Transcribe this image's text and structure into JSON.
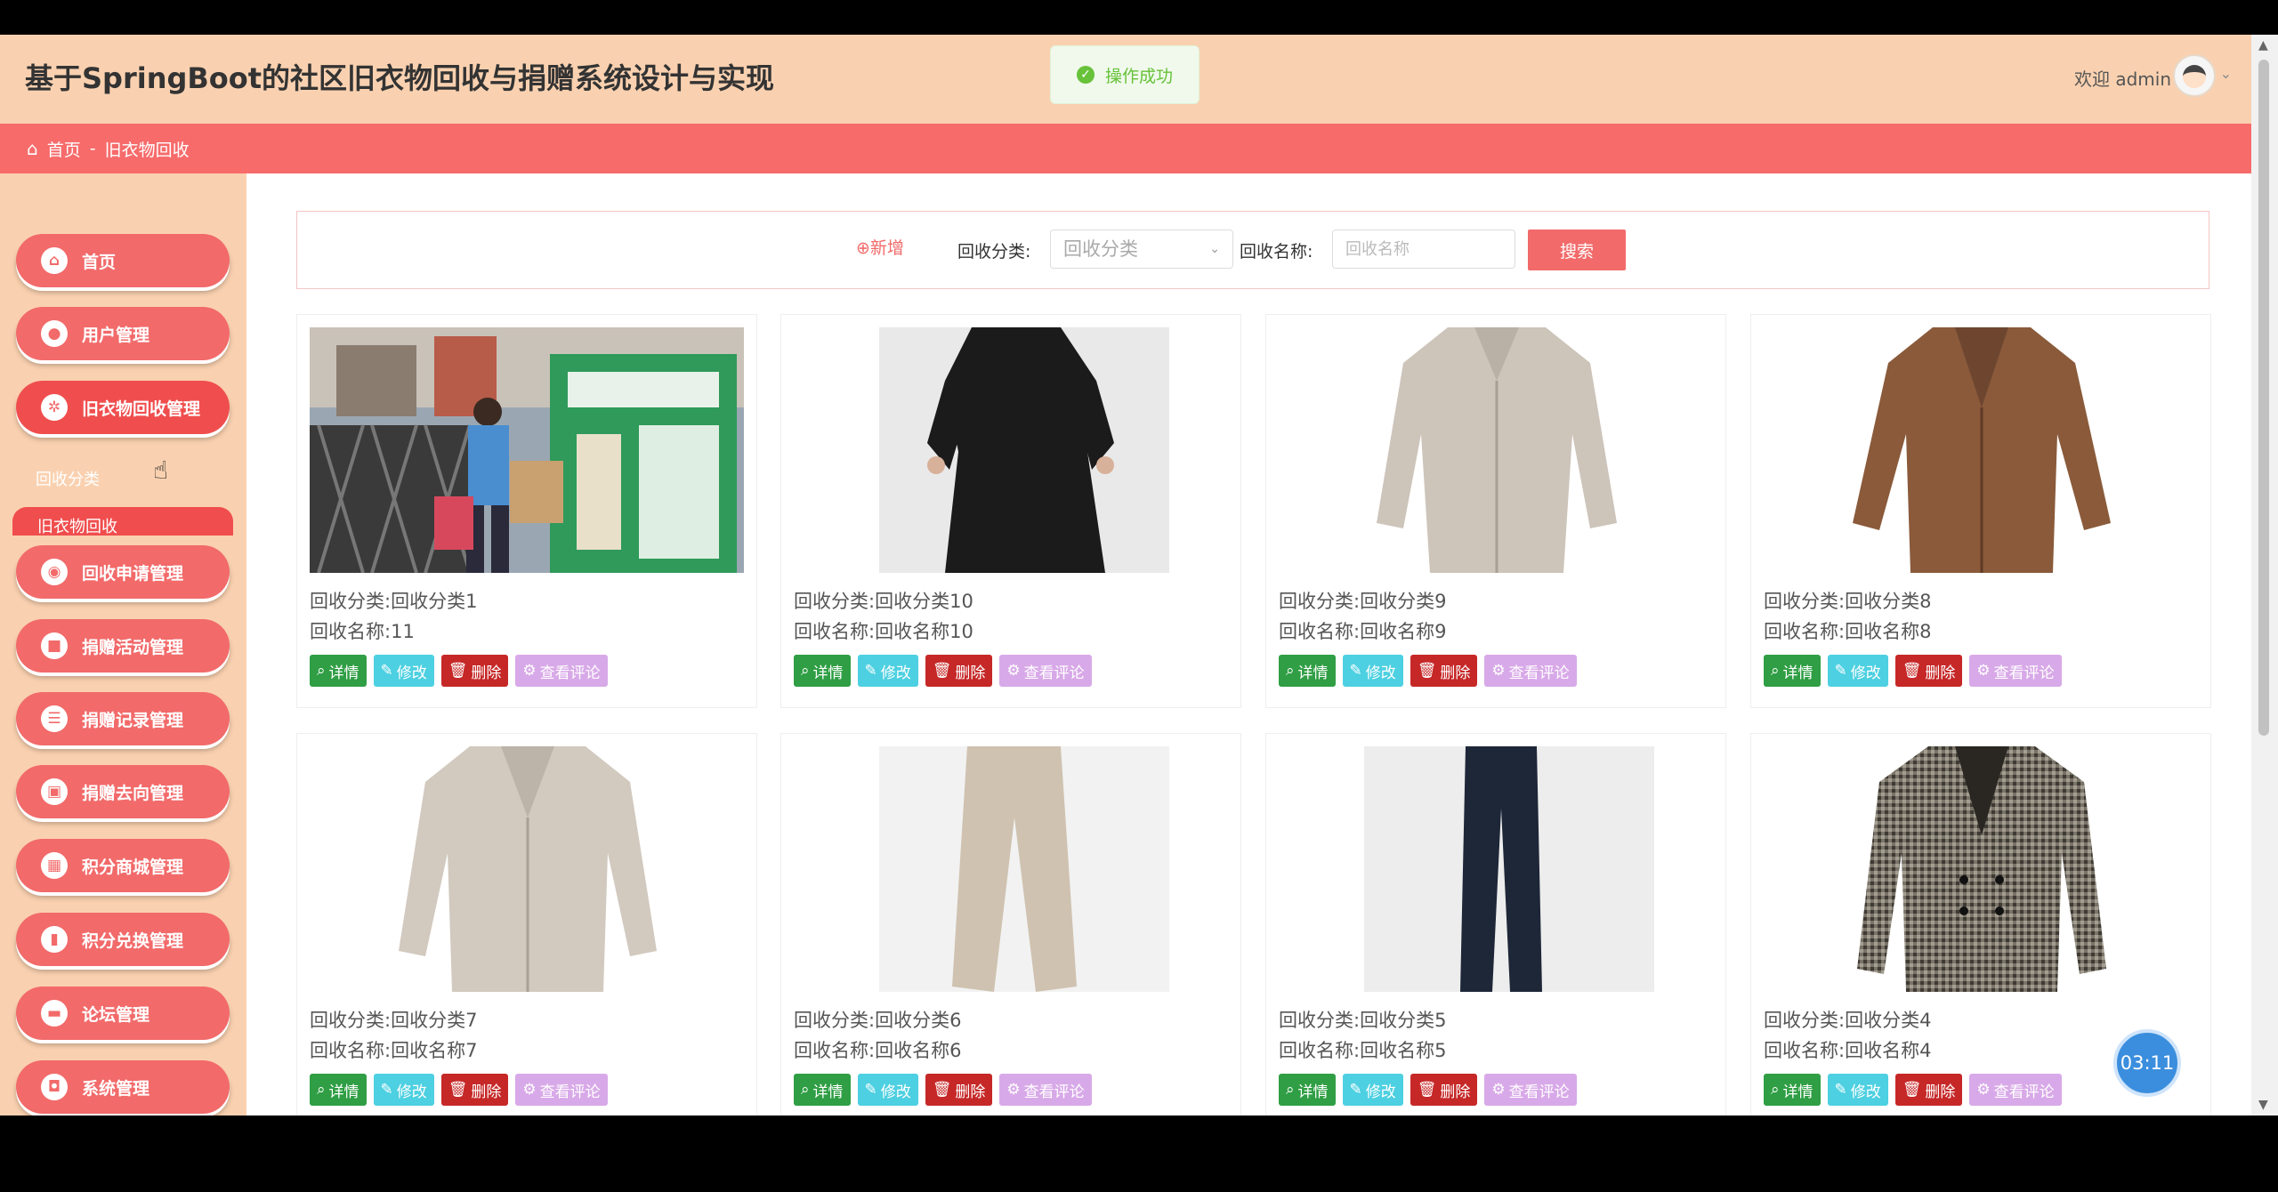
{
  "header": {
    "title": "基于SpringBoot的社区旧衣物回收与捐赠系统设计与实现",
    "toast": "操作成功",
    "welcome": "欢迎 admin"
  },
  "breadcrumb": {
    "home": "首页",
    "separator": "-",
    "current": "旧衣物回收"
  },
  "sidebar": {
    "items": [
      {
        "label": "首页",
        "icon": "home-icon"
      },
      {
        "label": "用户管理",
        "icon": "user-icon"
      },
      {
        "label": "旧衣物回收管理",
        "icon": "gear-icon"
      },
      {
        "label": "回收申请管理",
        "icon": "clipboard-icon"
      },
      {
        "label": "捐赠活动管理",
        "icon": "flag-icon"
      },
      {
        "label": "捐赠记录管理",
        "icon": "list-icon"
      },
      {
        "label": "捐赠去向管理",
        "icon": "route-icon"
      },
      {
        "label": "积分商城管理",
        "icon": "store-icon"
      },
      {
        "label": "积分兑换管理",
        "icon": "exchange-icon"
      },
      {
        "label": "论坛管理",
        "icon": "forum-icon"
      },
      {
        "label": "系统管理",
        "icon": "system-icon"
      }
    ],
    "subitems": [
      "回收分类",
      "旧衣物回收"
    ]
  },
  "search": {
    "add_label": "⊕新增",
    "category_label": "回收分类:",
    "category_placeholder": "回收分类",
    "name_label": "回收名称:",
    "name_placeholder": "回收名称",
    "search_label": "搜索"
  },
  "card_labels": {
    "category_prefix": "回收分类:",
    "name_prefix": "回收名称:",
    "detail": "详情",
    "edit": "修改",
    "delete": "删除",
    "comments": "查看评论"
  },
  "cards": [
    {
      "category": "回收分类1",
      "name": "11"
    },
    {
      "category": "回收分类10",
      "name": "回收名称10"
    },
    {
      "category": "回收分类9",
      "name": "回收名称9"
    },
    {
      "category": "回收分类8",
      "name": "回收名称8"
    },
    {
      "category": "回收分类7",
      "name": "回收名称7"
    },
    {
      "category": "回收分类6",
      "name": "回收名称6"
    },
    {
      "category": "回收分类5",
      "name": "回收名称5"
    },
    {
      "category": "回收分类4",
      "name": "回收名称4"
    }
  ],
  "timer": "03:11",
  "colors": {
    "header_bg": "#fad1b0",
    "accent": "#f26a6a",
    "detail_btn": "#2f9e44",
    "edit_btn": "#4dd0e1",
    "delete_btn": "#c62828",
    "comment_btn": "#d8a9e8"
  }
}
